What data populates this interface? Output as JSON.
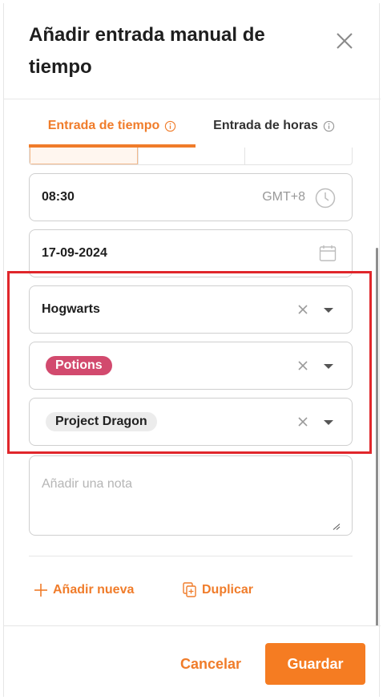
{
  "dialog": {
    "title": "Añadir entrada manual de tiempo"
  },
  "tabs": [
    {
      "label": "Entrada de tiempo",
      "active": true
    },
    {
      "label": "Entrada de horas",
      "active": false
    }
  ],
  "time": {
    "value": "08:30",
    "timezone": "GMT+8"
  },
  "date": {
    "value": "17-09-2024"
  },
  "client": {
    "value": "Hogwarts"
  },
  "tag": {
    "value": "Potions",
    "color": "#d24a6e"
  },
  "project": {
    "value": "Project Dragon"
  },
  "note": {
    "placeholder": "Añadir una nota"
  },
  "actions": {
    "add_new": "Añadir nueva",
    "duplicate": "Duplicar"
  },
  "footer": {
    "cancel": "Cancelar",
    "save": "Guardar"
  },
  "colors": {
    "accent": "#f07c2a",
    "highlight": "#e0262b"
  }
}
